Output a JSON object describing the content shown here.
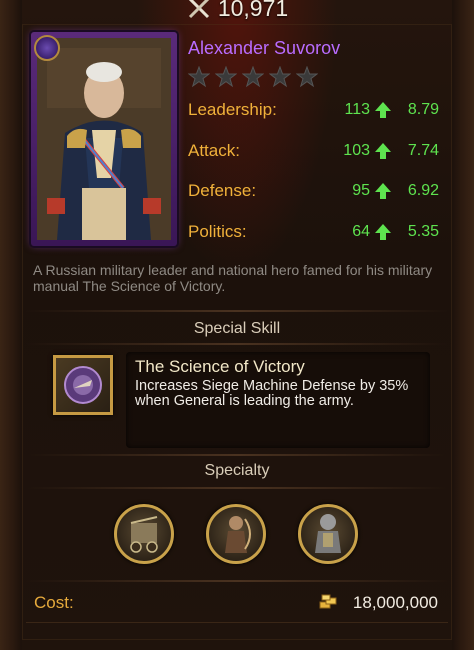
{
  "power": {
    "value": "10,971",
    "icon": "crossed-swords-icon"
  },
  "general": {
    "name": "Alexander Suvorov",
    "stars_total": 5,
    "stars_filled": 0,
    "rarity_color": "#b96cff",
    "description": "A Russian military leader and national hero famed for his military manual The Science of Victory."
  },
  "stats": [
    {
      "label": "Leadership:",
      "value": "113",
      "growth": "8.79"
    },
    {
      "label": "Attack:",
      "value": "103",
      "growth": "7.74"
    },
    {
      "label": "Defense:",
      "value": "95",
      "growth": "6.92"
    },
    {
      "label": "Politics:",
      "value": "64",
      "growth": "5.35"
    }
  ],
  "special_skill": {
    "heading": "Special Skill",
    "title": "The Science of Victory",
    "text": "Increases Siege Machine Defense by 35% when General is leading the army."
  },
  "specialty": {
    "heading": "Specialty",
    "icons": [
      "siege-engine-icon",
      "ranged-soldier-icon",
      "infantry-soldier-icon"
    ]
  },
  "cost": {
    "label": "Cost:",
    "value": "18,000,000",
    "icon": "gold-icon"
  },
  "colors": {
    "stat_label": "#f0b13a",
    "stat_value": "#5ee34f",
    "gold": "#c9a24a"
  }
}
